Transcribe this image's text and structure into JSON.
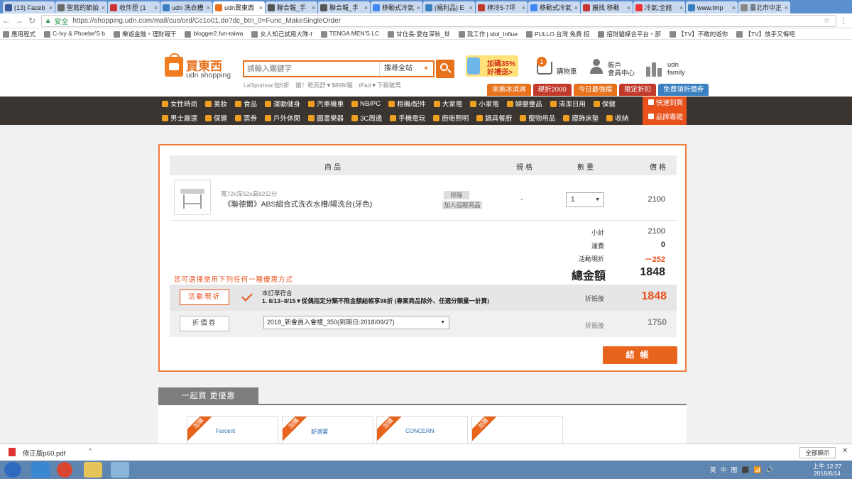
{
  "browser": {
    "tabs": [
      "(13) Faceb",
      "聖寫的節拍",
      "收件匣 (1",
      "udn 洗衣槽",
      "udn買東西",
      "聯合報_手",
      "聯合報_手",
      "移動式冷氣",
      "(福利品) E",
      "神冷5-7坪",
      "移動式冷氣",
      "搬找 移動",
      "冷氣:全館",
      "www.tmp",
      "臺北市中正"
    ],
    "active_tab": 4,
    "security": "安全",
    "url": "https://shopping.udn.com/mall/cus/ord/Cc1o01.do?dc_btn_0=Func_MakeSingleOrder",
    "bookmarks": [
      "應用程式",
      "C-Ivy & Phoebe'S b",
      "樂遊金融・理財報干",
      "blogger2.fun-taiwa",
      "女人知己試用大隊-f",
      "TENGA MEN'S LC",
      "甘仕長-愛在深秋_世",
      "我工作 | idol_Influe",
      "PULLO 台灣 免費 招",
      "招財貓媒合平台・部",
      "【TV】不敢的遊你",
      "【TV】放手又悔吧"
    ]
  },
  "header": {
    "logo_cn": "買東西",
    "logo_en": "udn shopping",
    "search_placeholder": "請輸入關鍵字",
    "search_scope": "搜尋全站",
    "hot_keywords": "LaSportsac包5折　搶！乾而舒▼$899/箱　iPad▼下殺破萬",
    "promo_line1": "加碼35%",
    "promo_line2": "好禮送>",
    "cart_count": "1",
    "cart_label": "購物車",
    "member_l1": "帳戶",
    "member_l2": "會員中心",
    "family_l1": "udn",
    "family_l2": "family",
    "promo_tabs": [
      {
        "label": "來揪冰淇淋",
        "color": "#e8711c"
      },
      {
        "label": "現折2000",
        "color": "#c0392b"
      },
      {
        "label": "今日最強檔",
        "color": "#e8711c"
      },
      {
        "label": "限定折扣",
        "color": "#c0392b"
      },
      {
        "label": "免費領折價券",
        "color": "#3a7fc0"
      }
    ]
  },
  "categories": {
    "row1": [
      "女性時尚",
      "美妝",
      "食品",
      "運動健身",
      "汽車機車",
      "NB/PC",
      "相機/配件",
      "大家電",
      "小家電",
      "婦嬰童品",
      "清潔日用",
      "保健"
    ],
    "row2": [
      "男士嚴選",
      "保健",
      "票券",
      "戶外休閒",
      "圖書樂器",
      "3C周邊",
      "手機電玩",
      "廚衛照明",
      "鍋具餐廚",
      "寵物用品",
      "寢飾床墊",
      "收納"
    ],
    "fast": "快速到貨",
    "brand": "品牌專館"
  },
  "cart": {
    "headers": {
      "product": "商品",
      "spec": "規格",
      "qty": "數量",
      "price": "價格"
    },
    "item": {
      "spec_text": "寬72x深52x高82公分",
      "name": "《聯德爾》ABS組合式洗衣水槽/陽洗台(牙色)",
      "remove": "移除",
      "add_fav": "加入追蹤商品",
      "spec": "-",
      "qty": "1",
      "price": "2100"
    },
    "subtotal_label": "小計",
    "subtotal": "2100",
    "shipping_label": "運費",
    "shipping": "0",
    "discount_label": "活動現折",
    "discount": "－252",
    "hint": "您可選擇使用下列任何一種優惠方式",
    "total_label": "總金額",
    "total": "1848",
    "event_btn": "活動現折",
    "event_line1": "本訂單符合",
    "event_line2": "1. 8/13~8/15▼從偶指定分類不限金額結帳享88折 (專案商品除外、任選分類量一計算)",
    "after_label": "折抵後",
    "after_value": "1848",
    "coupon_btn": "折價券",
    "coupon_select": "2018_新會員入會禮_350(到期日:2018/09/27)",
    "after_label2": "折抵後",
    "after_value2": "1750",
    "checkout": "結帳"
  },
  "together": {
    "title": "一起買 更優惠",
    "ribbon": "加購",
    "cards": [
      "Farcent",
      "舒適寶",
      "CONCERN",
      ""
    ]
  },
  "download": {
    "file": "修正版p60.pdf",
    "show_all": "全部顯示"
  },
  "taskbar": {
    "tray": "英 中 图 ⬛ 📶 🔊",
    "time": "上午 12:27",
    "date": "2018/8/14"
  }
}
